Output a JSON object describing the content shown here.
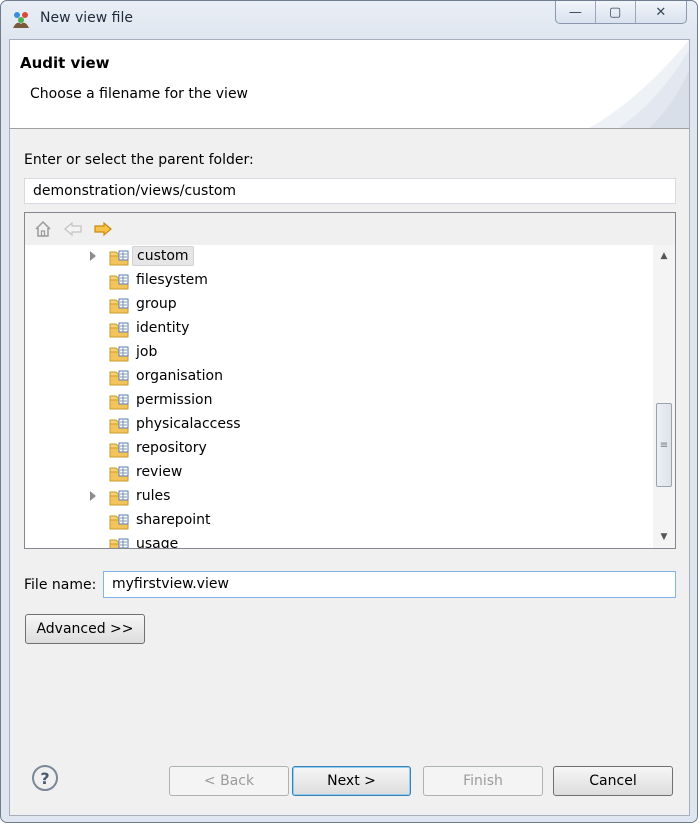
{
  "window": {
    "title": "New view file",
    "buttons": {
      "minimize": "—",
      "maximize": "▢",
      "close": "✕"
    }
  },
  "header": {
    "title": "Audit view",
    "description": "Choose a filename for the view"
  },
  "parent_folder": {
    "label": "Enter or select the parent folder:",
    "value": "demonstration/views/custom"
  },
  "toolbar": {
    "icons": [
      "home-icon",
      "back-arrow-icon",
      "forward-arrow-icon"
    ]
  },
  "tree": {
    "items": [
      {
        "label": "custom",
        "expandable": true,
        "selected": true
      },
      {
        "label": "filesystem",
        "expandable": false,
        "selected": false
      },
      {
        "label": "group",
        "expandable": false,
        "selected": false
      },
      {
        "label": "identity",
        "expandable": false,
        "selected": false
      },
      {
        "label": "job",
        "expandable": false,
        "selected": false
      },
      {
        "label": "organisation",
        "expandable": false,
        "selected": false
      },
      {
        "label": "permission",
        "expandable": false,
        "selected": false
      },
      {
        "label": "physicalaccess",
        "expandable": false,
        "selected": false
      },
      {
        "label": "repository",
        "expandable": false,
        "selected": false
      },
      {
        "label": "review",
        "expandable": false,
        "selected": false
      },
      {
        "label": "rules",
        "expandable": true,
        "selected": false
      },
      {
        "label": "sharepoint",
        "expandable": false,
        "selected": false
      },
      {
        "label": "usage",
        "expandable": false,
        "selected": false
      }
    ]
  },
  "filename": {
    "label": "File name:",
    "value": "myfirstview.view"
  },
  "buttons": {
    "advanced": "Advanced >>",
    "back": "< Back",
    "next": "Next >",
    "finish": "Finish",
    "cancel": "Cancel",
    "help": "?"
  },
  "colors": {
    "accent": "#3c7fb1",
    "folder": "#f2c55c",
    "arrow": "#f0a21e"
  }
}
